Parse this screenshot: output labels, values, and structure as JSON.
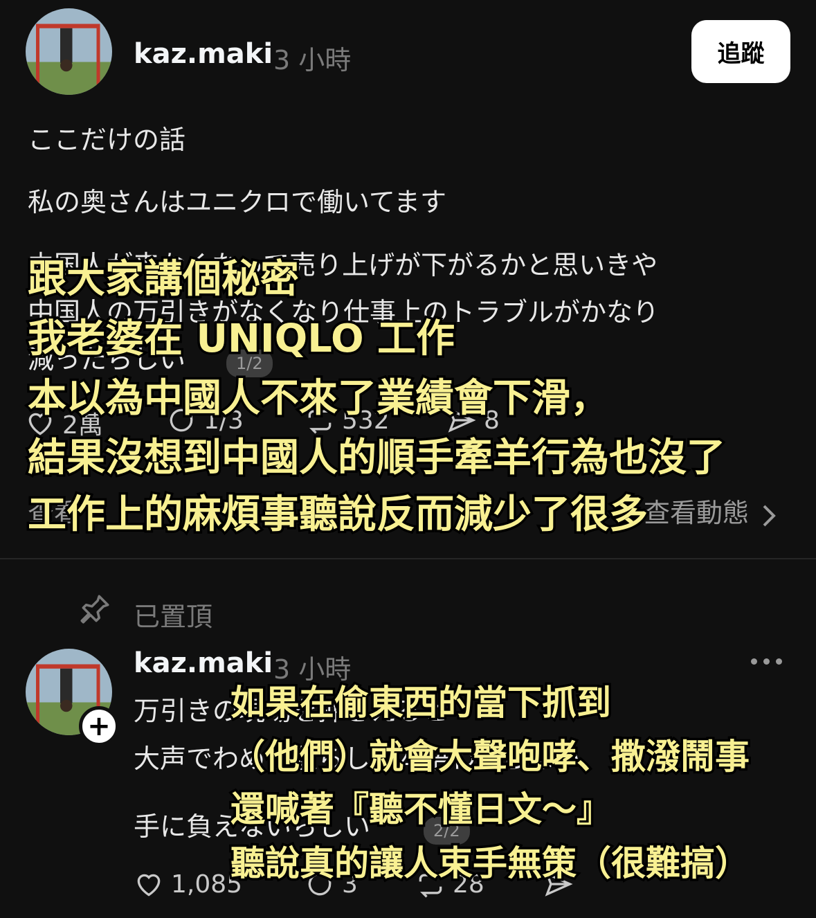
{
  "post1": {
    "username": "kaz.maki",
    "time": "3 小時",
    "follow_label": "追蹤",
    "lines": [
      "ここだけの話",
      "私の奥さんはユニクロで働いてます",
      "中国人が来なくなって売り上げが下がるかと思いきや",
      "中国人の万引きがなくなり仕事上のトラブルがかなり",
      "減ったらしい"
    ],
    "page_indicator": "1/2",
    "likes": "2萬",
    "comments": "1/3",
    "reposts": "532",
    "shares": "8",
    "activity_left": "查看",
    "activity_right": "查看動態"
  },
  "pinned": {
    "label": "已置頂"
  },
  "post2": {
    "username": "kaz.maki",
    "time": "3 小時",
    "lines": [
      "万引きの現場を押さえると",
      "大声でわめき散らし日本語わからない",
      "手に負えないらしい"
    ],
    "page_indicator": "2/2",
    "likes": "1,085",
    "comments": "3",
    "reposts": "28"
  },
  "overlay_top": [
    "跟大家講個秘密",
    "我老婆在 UNIQLO 工作",
    "本以為中國人不來了業績會下滑，",
    "結果沒想到中國人的順手牽羊行為也沒了",
    "工作上的麻煩事聽說反而減少了很多"
  ],
  "overlay_bottom": [
    "如果在偷東西的當下抓到",
    "（他們）就會大聲咆哮、撒潑鬧事",
    "還喊著『聽不懂日文～』",
    "聽說真的讓人束手無策（很難搞）"
  ],
  "colors": {
    "background": "#101010",
    "overlay_text": "#f8f092",
    "secondary_text": "#7a7a7a"
  }
}
